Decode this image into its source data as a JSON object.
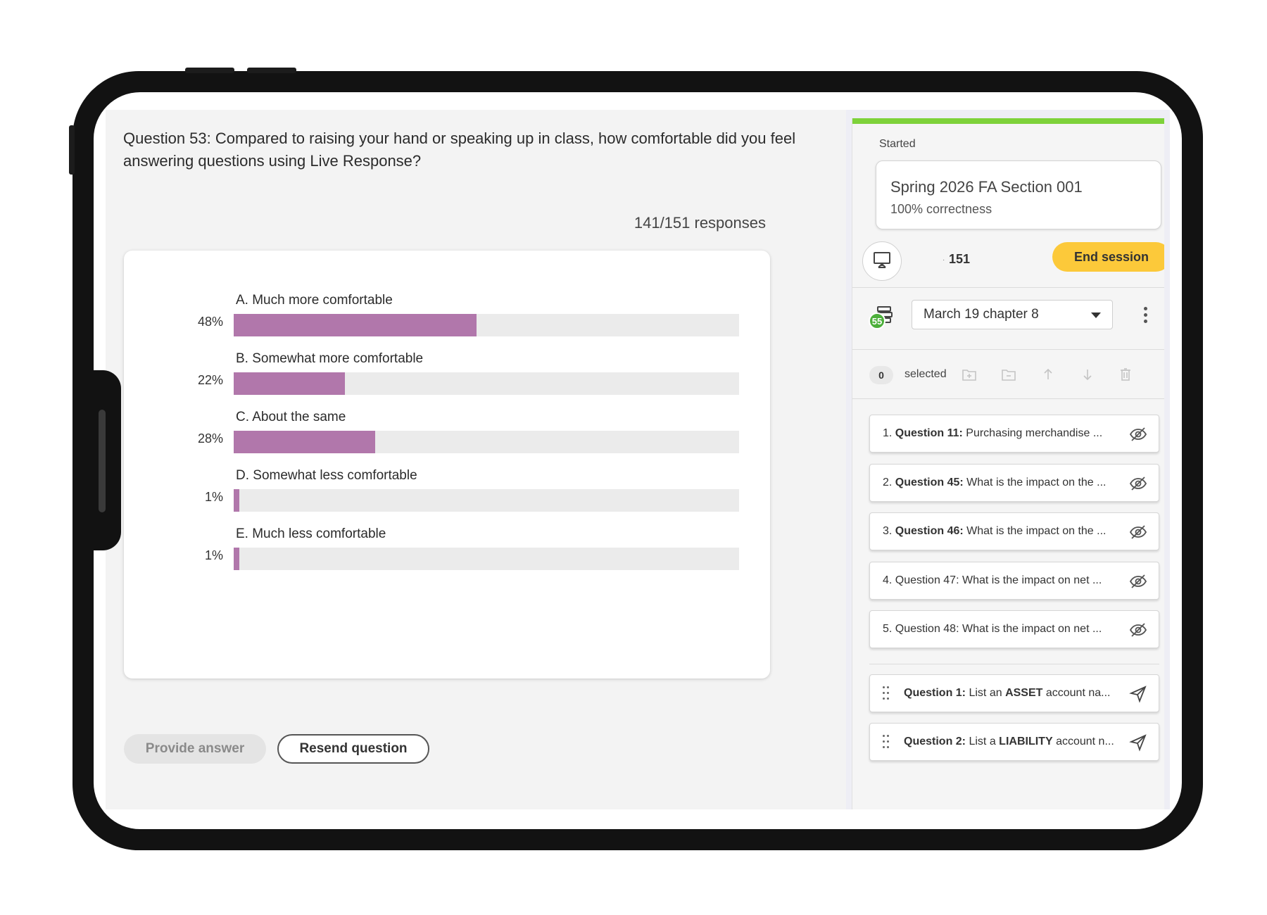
{
  "question": {
    "text": "Question 53: Compared to raising your hand or speaking up in class, how comfortable did you feel answering questions using Live Response?",
    "responses": "141/151 responses"
  },
  "chart_data": {
    "type": "bar",
    "categories": [
      "A. Much more comfortable",
      "B. Somewhat more comfortable",
      "C. About the same",
      "D. Somewhat less comfortable",
      "E. Much less comfortable"
    ],
    "values": [
      48,
      22,
      28,
      1,
      1
    ],
    "value_labels": [
      "48%",
      "22%",
      "28%",
      "1%",
      "1%"
    ],
    "ylim": [
      0,
      100
    ],
    "bar_color": "#b177ab",
    "track_color": "#ebebeb"
  },
  "actions": {
    "provide_answer": "Provide answer",
    "resend_question": "Resend question"
  },
  "session": {
    "status": "Started",
    "section_name": "Spring 2026 FA Section 001",
    "correctness": "100% correctness",
    "count_dot": "·",
    "count": "151",
    "end_label": "End session",
    "progress_color": "#7ed23a",
    "end_color": "#fcc93a"
  },
  "deck": {
    "badge": "55",
    "selected_deck": "March 19 chapter 8",
    "selected_count": "0",
    "selected_label": "selected"
  },
  "asked_questions": [
    {
      "num": "1.",
      "title": "Question 11:",
      "text": "Purchasing merchandise ..."
    },
    {
      "num": "2.",
      "title": "Question 45:",
      "text": "What is the impact on the ..."
    },
    {
      "num": "3.",
      "title": "Question 46:",
      "text": "What is the impact on the ..."
    },
    {
      "num": "4.",
      "title": "Question 47:",
      "text": "What is the impact on net ..."
    },
    {
      "num": "5.",
      "title": "Question 48:",
      "text": "What is the impact on net ..."
    }
  ],
  "queued_questions": [
    {
      "title": "Question 1:",
      "text_before": "List an",
      "keyword": "ASSET",
      "text_after": "account na..."
    },
    {
      "title": "Question 2:",
      "text_before": "List a",
      "keyword": "LIABILITY",
      "text_after": "account n..."
    }
  ]
}
